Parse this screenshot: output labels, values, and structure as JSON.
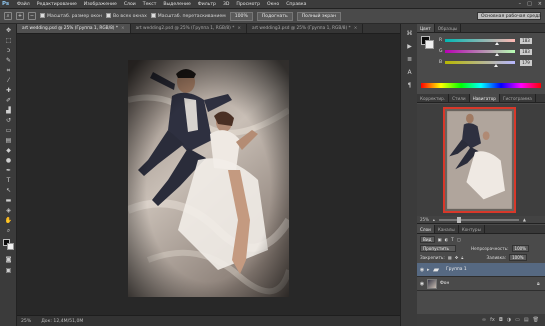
{
  "app": {
    "logo": "Ps"
  },
  "menu": [
    "Файл",
    "Редактирование",
    "Изображение",
    "Слои",
    "Текст",
    "Выделение",
    "Фильтр",
    "3D",
    "Просмотр",
    "Окно",
    "Справка"
  ],
  "window_controls": [
    "–",
    "□",
    "×"
  ],
  "options_bar": {
    "resize_windows": "Масштаб. размер окон",
    "all_windows": "Во всех окнах",
    "scrubby_zoom": "Масштаб. перетаскиванием",
    "zoom_100": "100%",
    "fit_screen": "Подогнать",
    "fill_screen": "Полный экран",
    "workspace": "Основная рабочая среда"
  },
  "tabs": [
    {
      "label": "art wedding.psd @ 25% (Группа 1, RGB/8) *",
      "active": true
    },
    {
      "label": "art wedding2.psd @ 25% (Группа 1, RGB/8) *",
      "active": false
    },
    {
      "label": "art wedding3.psd @ 25% (Группа 1, RGB/8) *",
      "active": false
    }
  ],
  "status": {
    "zoom": "25%",
    "doc": "Док: 12,4M/51,0M"
  },
  "color_panel": {
    "tabs": [
      "Цвет",
      "Образцы"
    ],
    "values": {
      "R": "183",
      "G": "183",
      "B": "179"
    },
    "colors": {
      "foreground": "#0c0c0c",
      "background": "#f0f0f0"
    }
  },
  "navigator": {
    "tabs": [
      "Корректир.",
      "Стили",
      "Навигатор",
      "Гистограмма"
    ],
    "zoom": "25%"
  },
  "layers": {
    "tabs": [
      "Слои",
      "Каналы",
      "Контуры"
    ],
    "kind": "Вид",
    "blend": "Пропустить",
    "opacity_label": "Непрозрачность:",
    "opacity": "100%",
    "lock_label": "Закрепить:",
    "fill_label": "Заливка:",
    "fill": "100%",
    "items": [
      {
        "name": "Группа 1",
        "selected": true
      },
      {
        "name": "Фон",
        "selected": false
      }
    ]
  }
}
